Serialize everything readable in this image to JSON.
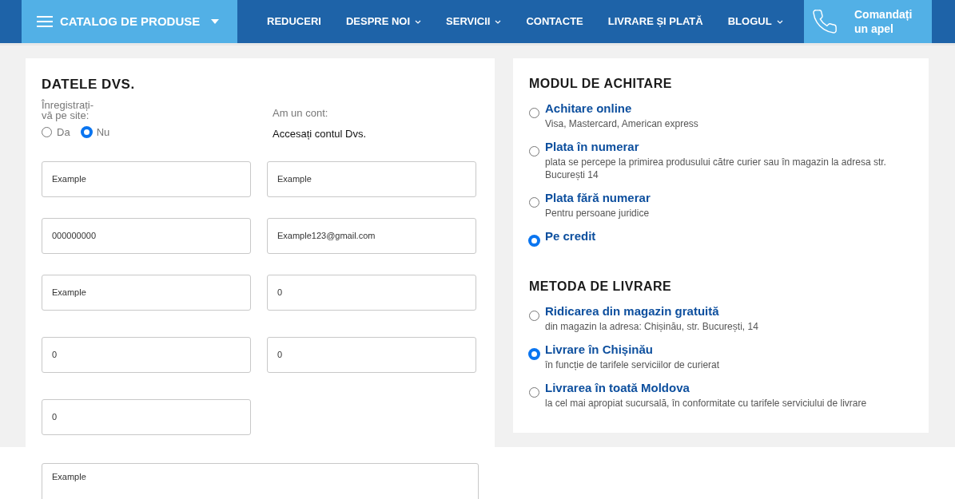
{
  "header": {
    "catalog": "CATALOG DE PRODUSE",
    "nav": [
      {
        "label": "REDUCERI",
        "has_dropdown": false
      },
      {
        "label": "DESPRE NOI",
        "has_dropdown": true
      },
      {
        "label": "SERVICII",
        "has_dropdown": true
      },
      {
        "label": "CONTACTE",
        "has_dropdown": false
      },
      {
        "label": "LIVRARE ȘI PLATĂ",
        "has_dropdown": false
      },
      {
        "label": "BLOGUL",
        "has_dropdown": true
      }
    ],
    "call_button": [
      "Comandați",
      "un apel"
    ]
  },
  "personal": {
    "title": "DATELE DVS.",
    "register_label": [
      "Înregistrați-",
      "vă pe site:"
    ],
    "register_options": [
      {
        "label": "Da",
        "selected": false
      },
      {
        "label": "Nu",
        "selected": true
      }
    ],
    "account_label": "Am un cont:",
    "account_link": "Accesați contul Dvs.",
    "fields": [
      {
        "value": "Example"
      },
      {
        "value": "Example"
      },
      {
        "value": "000000000"
      },
      {
        "value": "Example123@gmail.com"
      },
      {
        "value": "Example"
      },
      {
        "value": "0"
      },
      {
        "value": "0"
      },
      {
        "value": "0"
      },
      {
        "value": "0"
      }
    ],
    "comment": "Example"
  },
  "payment": {
    "title": "MODUL DE ACHITARE",
    "options": [
      {
        "label": "Achitare online",
        "description": "Visa, Mastercard, American express",
        "selected": false
      },
      {
        "label": "Plata în numerar",
        "description": "plata se percepe la primirea produsului către curier sau în magazin la adresa str. București 14",
        "selected": false
      },
      {
        "label": "Plata fără numerar",
        "description": "Pentru persoane juridice",
        "selected": false
      },
      {
        "label": "Pe credit",
        "selected": true
      }
    ]
  },
  "delivery": {
    "title": "METODA DE LIVRARE",
    "options": [
      {
        "label": "Ridicarea din magazin gratuită",
        "description": "din magazin la adresa: Chișinău, str. București, 14",
        "selected": false
      },
      {
        "label": "Livrare în Chișinău",
        "description": "în funcție de tarifele serviciilor de curierat",
        "selected": true
      },
      {
        "label": "Livrarea în toată Moldova",
        "description": "la cel mai apropiat sucursală, în conformitate cu tarifele serviciului de livrare",
        "selected": false
      }
    ]
  }
}
